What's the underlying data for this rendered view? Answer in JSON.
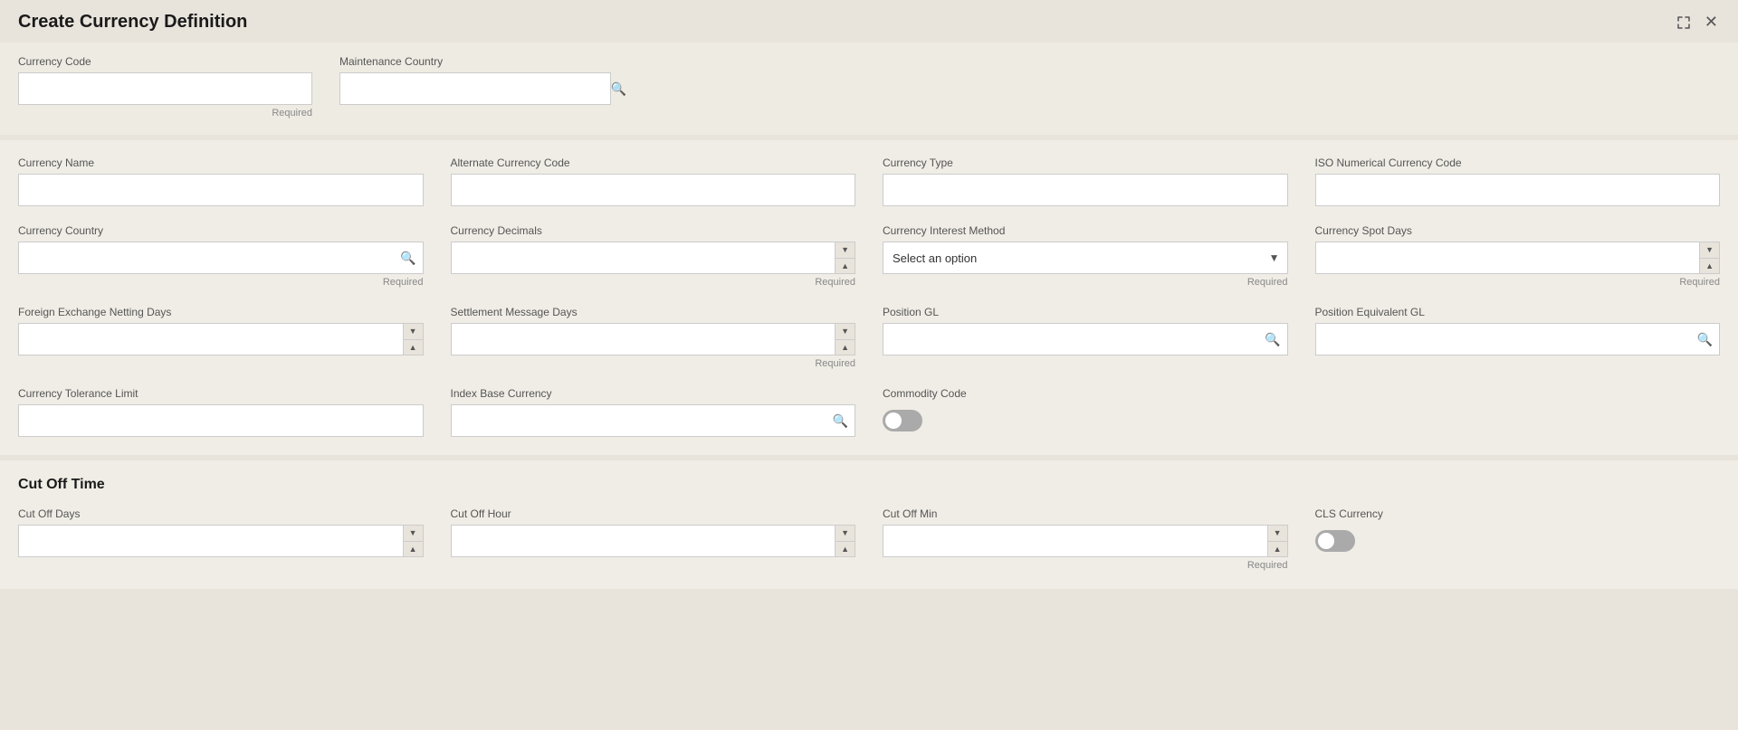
{
  "header": {
    "title": "Create Currency Definition",
    "maximize_icon": "⤢",
    "close_icon": "✕"
  },
  "section1": {
    "fields": {
      "currency_code": {
        "label": "Currency Code",
        "value": "",
        "required": "Required"
      },
      "maintenance_country": {
        "label": "Maintenance Country",
        "value": "",
        "placeholder": ""
      }
    }
  },
  "section2": {
    "fields": {
      "currency_name": {
        "label": "Currency Name",
        "value": ""
      },
      "alternate_currency_code": {
        "label": "Alternate Currency Code",
        "value": ""
      },
      "currency_type": {
        "label": "Currency Type",
        "value": ""
      },
      "iso_numerical_currency_code": {
        "label": "ISO Numerical Currency Code",
        "value": ""
      },
      "currency_country": {
        "label": "Currency Country",
        "value": "",
        "required": "Required"
      },
      "currency_decimals": {
        "label": "Currency Decimals",
        "value": "",
        "required": "Required"
      },
      "currency_interest_method": {
        "label": "Currency Interest Method",
        "value": "",
        "placeholder": "Select an option",
        "required": "Required"
      },
      "currency_spot_days": {
        "label": "Currency Spot Days",
        "value": "",
        "required": "Required"
      },
      "foreign_exchange_netting_days": {
        "label": "Foreign Exchange Netting Days",
        "value": ""
      },
      "settlement_message_days": {
        "label": "Settlement Message Days",
        "value": "",
        "required": "Required"
      },
      "position_gl": {
        "label": "Position GL",
        "value": ""
      },
      "position_equivalent_gl": {
        "label": "Position Equivalent GL",
        "value": ""
      },
      "currency_tolerance_limit": {
        "label": "Currency Tolerance Limit",
        "value": ""
      },
      "index_base_currency": {
        "label": "Index Base Currency",
        "value": ""
      },
      "commodity_code": {
        "label": "Commodity Code"
      }
    }
  },
  "section3": {
    "title": "Cut Off Time",
    "fields": {
      "cut_off_days": {
        "label": "Cut Off Days",
        "value": ""
      },
      "cut_off_hour": {
        "label": "Cut Off Hour",
        "value": ""
      },
      "cut_off_min": {
        "label": "Cut Off Min",
        "value": "",
        "required": "Required"
      },
      "cls_currency": {
        "label": "CLS Currency"
      }
    }
  },
  "icons": {
    "search": "🔍",
    "chevron_down": "▾",
    "chevron_up": "▴",
    "close": "✕",
    "maximize": "⤢"
  }
}
